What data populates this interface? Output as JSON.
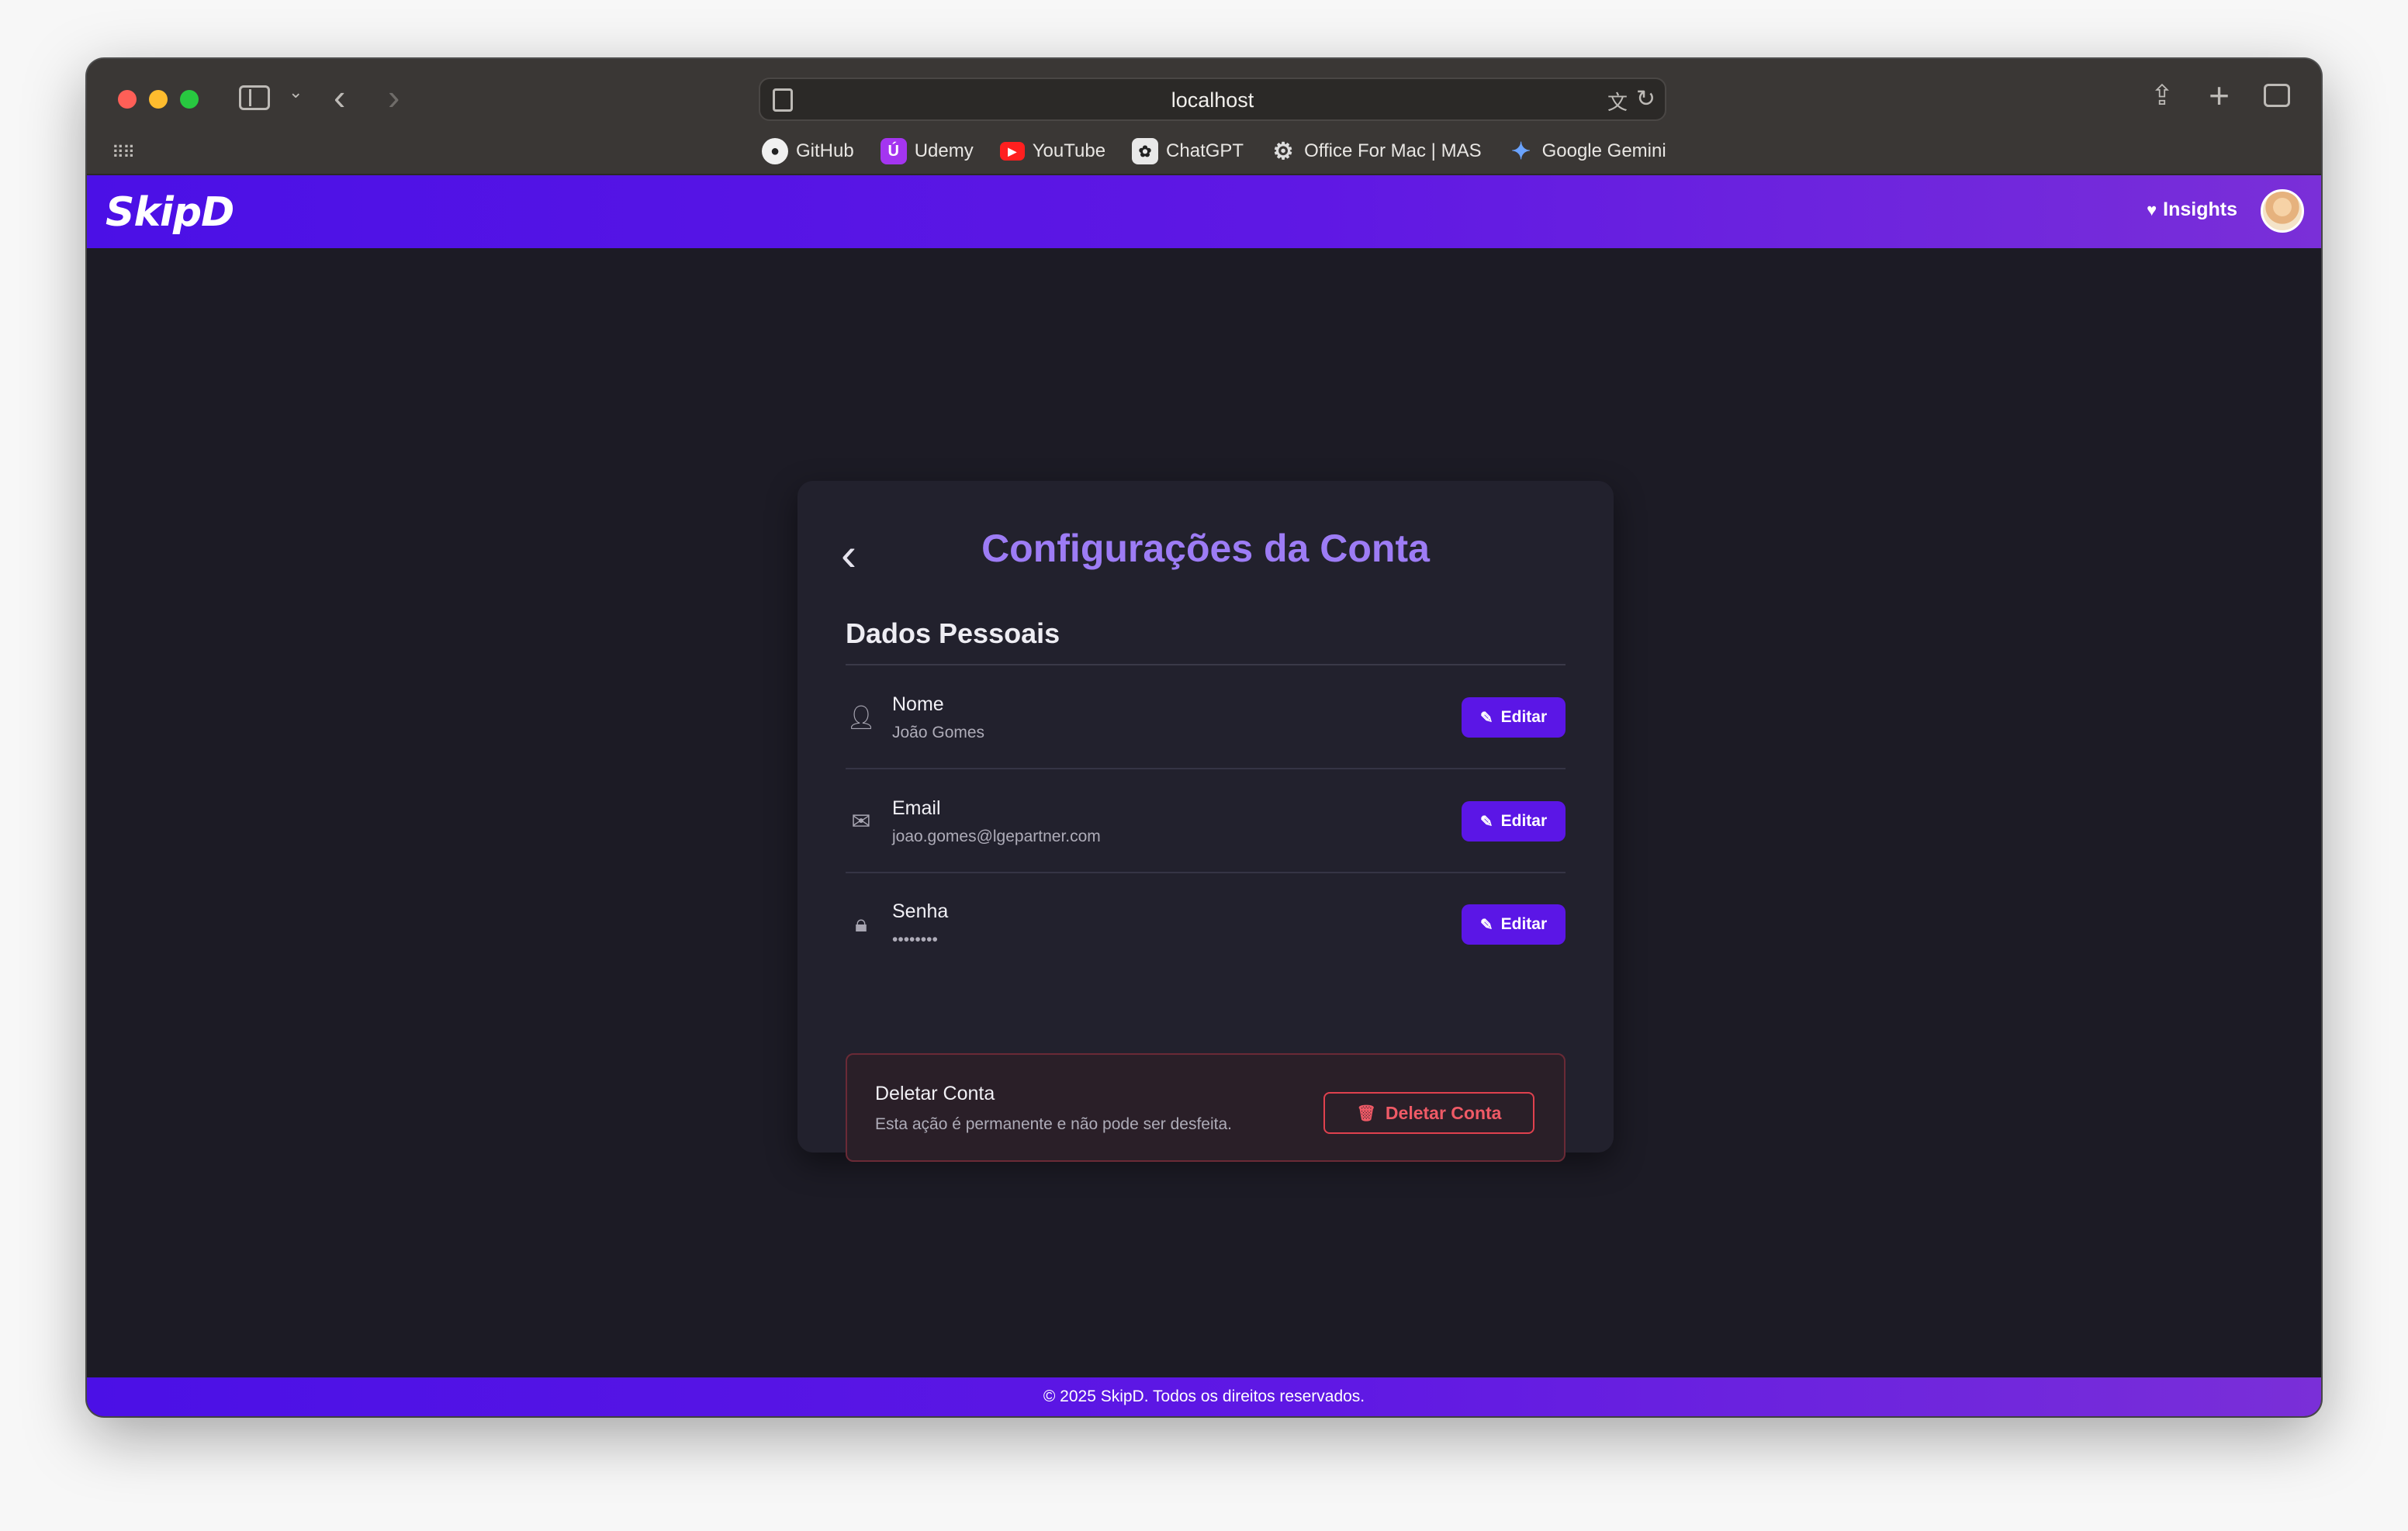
{
  "browser": {
    "url": "localhost",
    "bookmarks": [
      {
        "label": "GitHub"
      },
      {
        "label": "Udemy"
      },
      {
        "label": "YouTube"
      },
      {
        "label": "ChatGPT"
      },
      {
        "label": "Office For Mac | MAS"
      },
      {
        "label": "Google Gemini"
      }
    ]
  },
  "header": {
    "logo": "SkipD",
    "insights_label": "Insights",
    "brand_color": "#5b16e6"
  },
  "card": {
    "title": "Configurações da Conta",
    "section_title": "Dados Pessoais",
    "fields": [
      {
        "label": "Nome",
        "value": "João Gomes",
        "icon": "person-icon",
        "button": "Editar"
      },
      {
        "label": "Email",
        "value": "joao.gomes@lgepartner.com",
        "icon": "mail-icon",
        "button": "Editar"
      },
      {
        "label": "Senha",
        "value": "••••••••",
        "icon": "lock-icon",
        "button": "Editar"
      }
    ],
    "danger": {
      "title": "Deletar Conta",
      "subtitle": "Esta ação é permanente e não pode ser desfeita.",
      "button": "Deletar Conta",
      "color": "#e0414e"
    }
  },
  "footer": {
    "text": "© 2025 SkipD. Todos os direitos reservados."
  }
}
